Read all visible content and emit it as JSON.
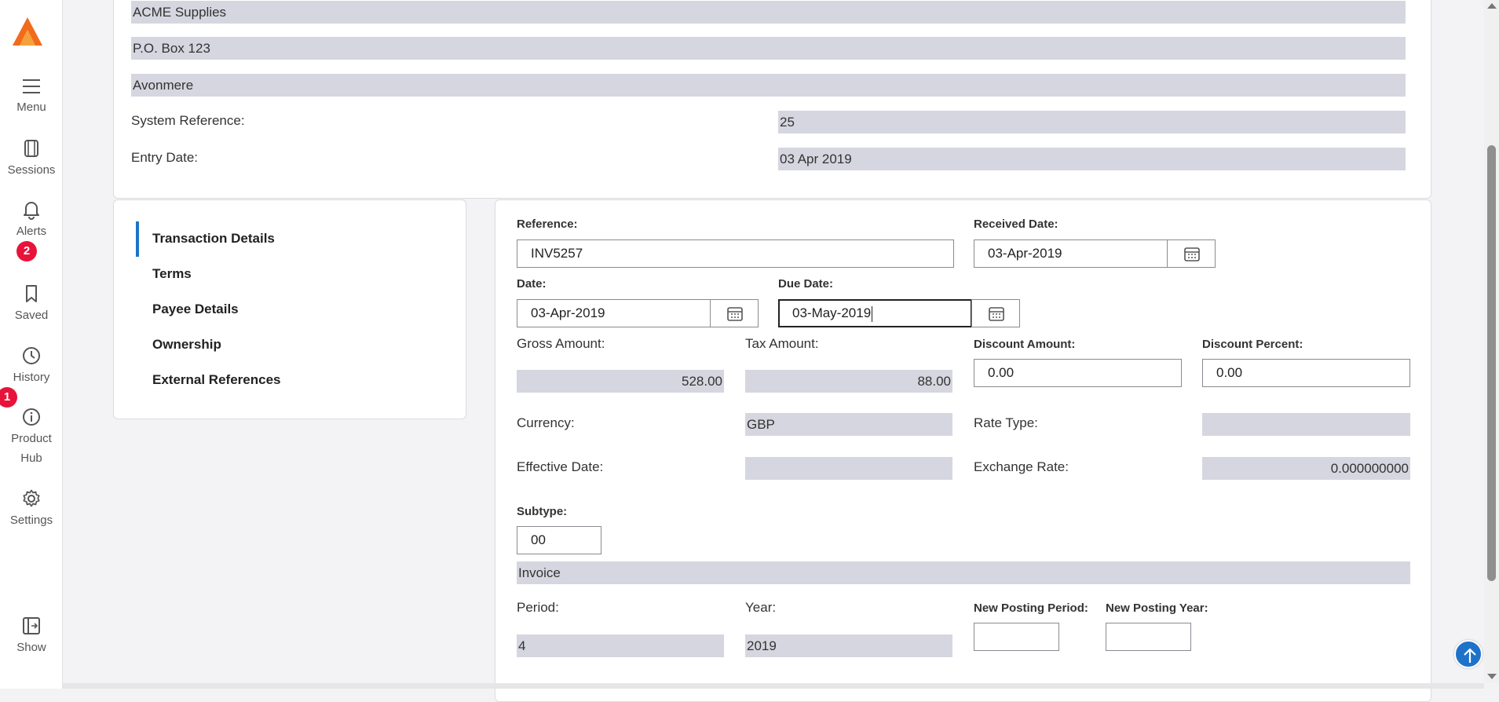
{
  "nav": {
    "menu": "Menu",
    "sessions": "Sessions",
    "alerts": "Alerts",
    "alerts_count": "2",
    "saved": "Saved",
    "history": "History",
    "history_count": "1",
    "product_hub_line1": "Product",
    "product_hub_line2": "Hub",
    "settings": "Settings",
    "show": "Show"
  },
  "header_card": {
    "supplier_name": "ACME Supplies",
    "address_line1": "P.O. Box 123",
    "address_line2": "Avonmere",
    "system_reference_label": "System Reference:",
    "system_reference_value": "25",
    "entry_date_label": "Entry Date:",
    "entry_date_value": "03 Apr 2019"
  },
  "sidebar": {
    "items": [
      {
        "label": "Transaction Details",
        "active": true
      },
      {
        "label": "Terms"
      },
      {
        "label": "Payee Details"
      },
      {
        "label": "Ownership"
      },
      {
        "label": "External References"
      }
    ]
  },
  "form": {
    "reference_label": "Reference:",
    "reference_value": "INV5257",
    "received_date_label": "Received Date:",
    "received_date_value": "03-Apr-2019",
    "date_label": "Date:",
    "date_value": "03-Apr-2019",
    "due_date_label": "Due Date:",
    "due_date_value": "03-May-2019",
    "gross_amount_label": "Gross Amount:",
    "gross_amount_value": "528.00",
    "tax_amount_label": "Tax Amount:",
    "tax_amount_value": "88.00",
    "discount_amount_label": "Discount Amount:",
    "discount_amount_value": "0.00",
    "discount_percent_label": "Discount Percent:",
    "discount_percent_value": "0.00",
    "currency_label": "Currency:",
    "currency_value": "GBP",
    "rate_type_label": "Rate Type:",
    "rate_type_value": "",
    "effective_date_label": "Effective Date:",
    "effective_date_value": "",
    "exchange_rate_label": "Exchange Rate:",
    "exchange_rate_value": "0.000000000",
    "subtype_label": "Subtype:",
    "subtype_value": "00",
    "subtype_description": "Invoice",
    "period_label": "Period:",
    "period_value": "4",
    "year_label": "Year:",
    "year_value": "2019",
    "new_posting_period_label": "New Posting Period:",
    "new_posting_period_value": "",
    "new_posting_year_label": "New Posting Year:",
    "new_posting_year_value": ""
  },
  "colors": {
    "accent": "#1e73c8",
    "badge": "#e8133a",
    "readonly_bg": "#d6d6e0"
  }
}
